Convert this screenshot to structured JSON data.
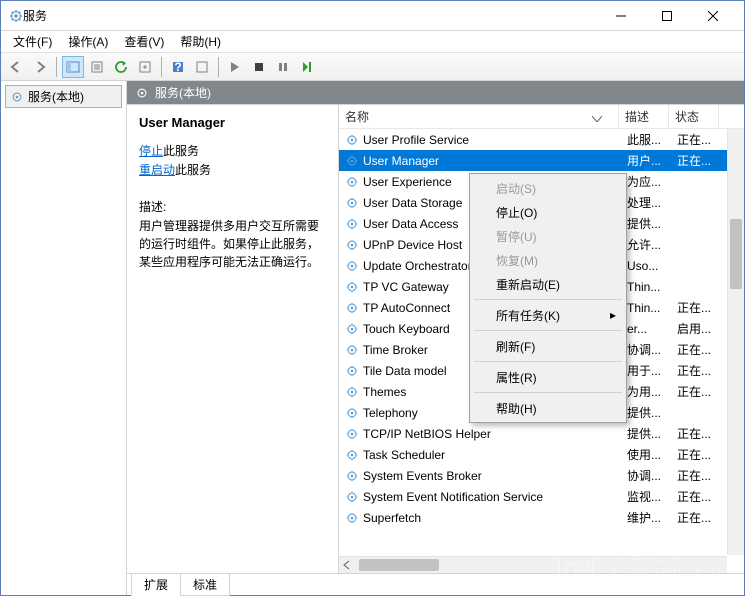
{
  "window": {
    "title": "服务"
  },
  "menu": {
    "file": "文件(F)",
    "action": "操作(A)",
    "view": "查看(V)",
    "help": "帮助(H)"
  },
  "sidebar": {
    "root": "服务(本地)"
  },
  "panel_header": "服务(本地)",
  "details": {
    "title": "User Manager",
    "stop_link": "停止",
    "stop_suffix": "此服务",
    "restart_link": "重启动",
    "restart_suffix": "此服务",
    "desc_label": "描述:",
    "desc_text": "用户管理器提供多用户交互所需要的运行时组件。如果停止此服务，某些应用程序可能无法正确运行。"
  },
  "columns": {
    "name": "名称",
    "desc": "描述",
    "status": "状态"
  },
  "services": [
    {
      "name": "User Profile Service",
      "desc": "此服...",
      "status": "正在..."
    },
    {
      "name": "User Manager",
      "desc": "用户...",
      "status": "正在...",
      "selected": true
    },
    {
      "name": "User Experience",
      "desc": "为应...",
      "status": ""
    },
    {
      "name": "User Data Storage",
      "desc": "处理...",
      "status": ""
    },
    {
      "name": "User Data Access",
      "desc": "提供...",
      "status": ""
    },
    {
      "name": "UPnP Device Host",
      "desc": "允许...",
      "status": ""
    },
    {
      "name": "Update Orchestrator",
      "desc": "Uso...",
      "status": ""
    },
    {
      "name": "TP VC Gateway",
      "desc": "Thin...",
      "status": ""
    },
    {
      "name": "TP AutoConnect",
      "desc": "Thin...",
      "status": "正在..."
    },
    {
      "name": "Touch Keyboard",
      "desc": "er...",
      "status": "启用..."
    },
    {
      "name": "Time Broker",
      "desc": "协调...",
      "status": "正在..."
    },
    {
      "name": "Tile Data model",
      "desc": "用于...",
      "status": "正在..."
    },
    {
      "name": "Themes",
      "desc": "为用...",
      "status": "正在..."
    },
    {
      "name": "Telephony",
      "desc": "提供...",
      "status": ""
    },
    {
      "name": "TCP/IP NetBIOS Helper",
      "desc": "提供...",
      "status": "正在..."
    },
    {
      "name": "Task Scheduler",
      "desc": "使用...",
      "status": "正在..."
    },
    {
      "name": "System Events Broker",
      "desc": "协调...",
      "status": "正在..."
    },
    {
      "name": "System Event Notification Service",
      "desc": "监视...",
      "status": "正在..."
    },
    {
      "name": "Superfetch",
      "desc": "维护...",
      "status": "正在..."
    }
  ],
  "context_menu": {
    "start": "启动(S)",
    "stop": "停止(O)",
    "pause": "暂停(U)",
    "resume": "恢复(M)",
    "restart": "重新启动(E)",
    "all_tasks": "所有任务(K)",
    "refresh": "刷新(F)",
    "properties": "属性(R)",
    "help": "帮助(H)"
  },
  "tabs": {
    "extended": "扩展",
    "standard": "标准"
  },
  "watermark": {
    "text": "系统之家",
    "sub": "XITONGZHIJIA.NET"
  }
}
